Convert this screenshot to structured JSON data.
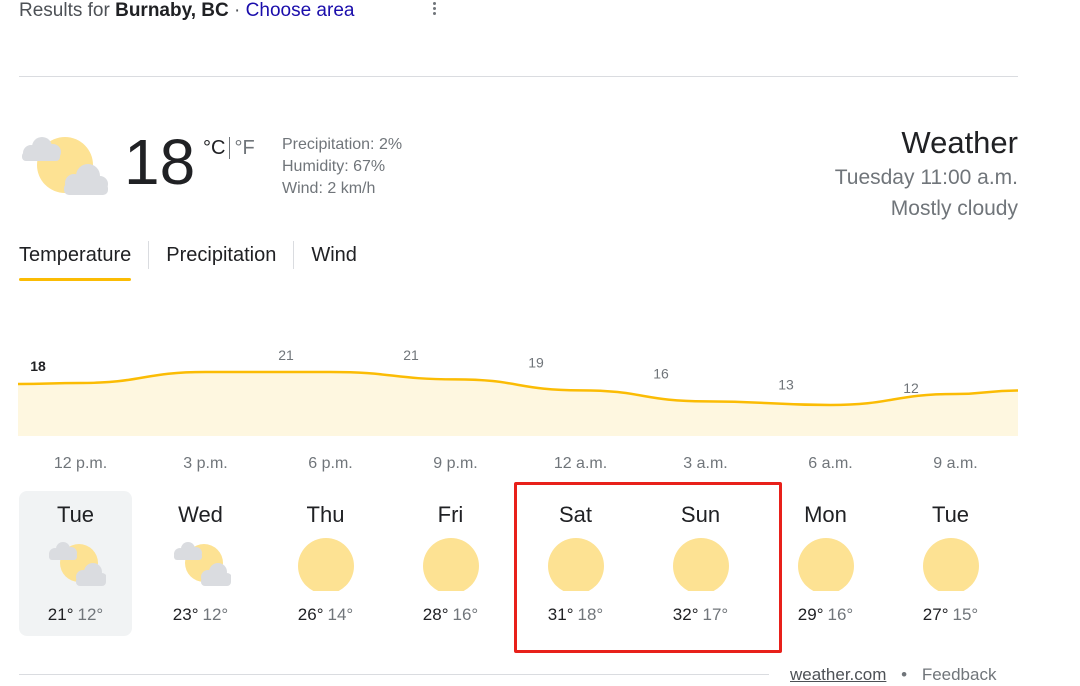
{
  "results": {
    "prefix": "Results for",
    "location": "Burnaby, BC",
    "separator": "·",
    "choose_area": "Choose area"
  },
  "current": {
    "icon": "partly-cloudy-icon",
    "temp": "18",
    "unit_c": "°C",
    "unit_f": "°F",
    "precipitation": "Precipitation: 2%",
    "humidity": "Humidity: 67%",
    "wind": "Wind: 2 km/h"
  },
  "header": {
    "title": "Weather",
    "time": "Tuesday 11:00 a.m.",
    "condition": "Mostly cloudy"
  },
  "tabs": [
    {
      "label": "Temperature",
      "active": true
    },
    {
      "label": "Precipitation",
      "active": false
    },
    {
      "label": "Wind",
      "active": false
    }
  ],
  "chart_data": {
    "type": "area",
    "x": [
      "12 p.m.",
      "3 p.m.",
      "6 p.m.",
      "9 p.m.",
      "12 a.m.",
      "3 a.m.",
      "6 a.m.",
      "9 a.m."
    ],
    "values": [
      18,
      21,
      21,
      19,
      16,
      13,
      12,
      15
    ],
    "line_color": "#fbbc04",
    "fill_color": "#fef7e0"
  },
  "days": [
    {
      "name": "Tue",
      "icon": "partly-cloudy-icon",
      "high": "21°",
      "low": "12°",
      "selected": true
    },
    {
      "name": "Wed",
      "icon": "partly-cloudy-icon",
      "high": "23°",
      "low": "12°",
      "selected": false
    },
    {
      "name": "Thu",
      "icon": "sun-icon",
      "high": "26°",
      "low": "14°",
      "selected": false
    },
    {
      "name": "Fri",
      "icon": "sun-icon",
      "high": "28°",
      "low": "16°",
      "selected": false
    },
    {
      "name": "Sat",
      "icon": "sun-icon",
      "high": "31°",
      "low": "18°",
      "selected": false
    },
    {
      "name": "Sun",
      "icon": "sun-icon",
      "high": "32°",
      "low": "17°",
      "selected": false
    },
    {
      "name": "Mon",
      "icon": "sun-icon",
      "high": "29°",
      "low": "16°",
      "selected": false
    },
    {
      "name": "Tue",
      "icon": "sun-icon",
      "high": "27°",
      "low": "15°",
      "selected": false
    }
  ],
  "footer": {
    "source": "weather.com",
    "dot": "•",
    "feedback": "Feedback"
  },
  "colors": {
    "highlight": "#e8201a",
    "sun": "#fde293",
    "cloud": "#dadce0",
    "tab_accent": "#fbbc04"
  }
}
